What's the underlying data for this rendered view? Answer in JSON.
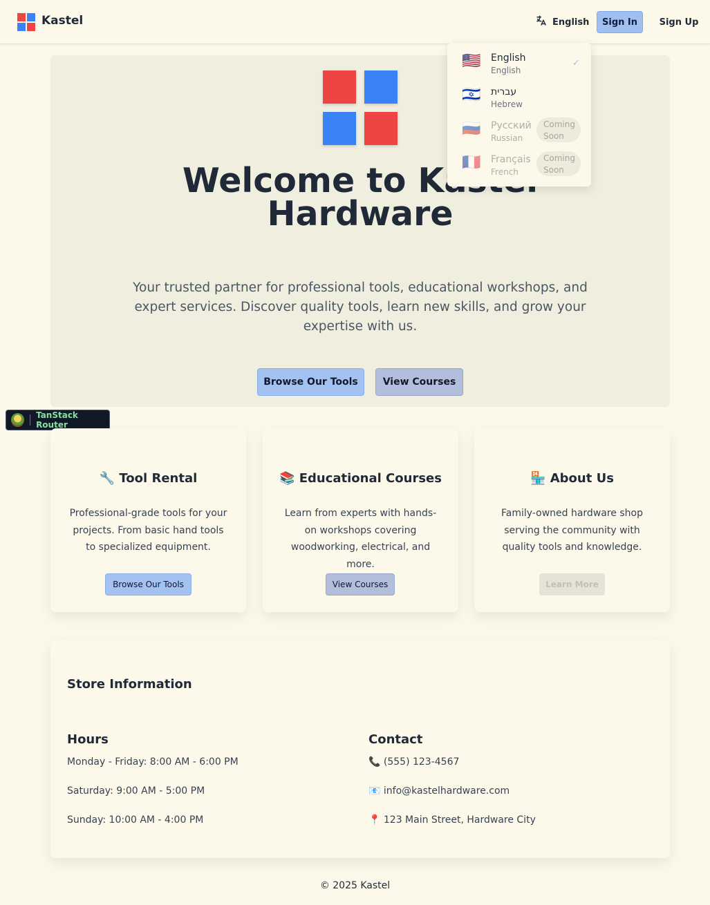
{
  "colors": {
    "brand_red": "#ef4444",
    "brand_blue": "#3b82f6",
    "primary_button": "#a3c2f2",
    "secondary_button": "#b2bedb"
  },
  "header": {
    "brand": "Kastel",
    "language_icon": "translate-icon",
    "language_label": "English",
    "sign_in": "Sign In",
    "sign_up": "Sign Up"
  },
  "language_menu": {
    "items": [
      {
        "flag": "🇺🇸",
        "name": "English",
        "sub": "English",
        "selected": true,
        "check": "✓"
      },
      {
        "flag": "🇮🇱",
        "name": "עברית",
        "sub": "Hebrew"
      },
      {
        "flag": "🇷🇺",
        "name": "Русский",
        "sub": "Russian",
        "badge": "Coming Soon"
      },
      {
        "flag": "🇫🇷",
        "name": "Français",
        "sub": "French",
        "badge": "Coming Soon"
      }
    ]
  },
  "hero": {
    "title": "Welcome to Kastel Hardware",
    "subtitle": "Your trusted partner for professional tools, educational workshops, and expert services. Discover quality tools, learn new skills, and grow your expertise with us.",
    "browse_button": "Browse Our Tools",
    "courses_button": "View Courses"
  },
  "devtools": {
    "label": "TanStack Router"
  },
  "features": [
    {
      "title": "🔧 Tool Rental",
      "description": "Professional-grade tools for your projects. From basic hand tools to specialized equipment.",
      "button": "Browse Our Tools"
    },
    {
      "title": "📚 Educational Courses",
      "description": "Learn from experts with hands-on workshops covering woodworking, electrical, and more.",
      "button": "View Courses"
    },
    {
      "title": "🏪 About Us",
      "description": "Family-owned hardware shop serving the community with quality tools and knowledge.",
      "button": "Learn More"
    }
  ],
  "store": {
    "title": "Store Information",
    "hours_title": "Hours",
    "hours": [
      "Monday - Friday: 8:00 AM - 6:00 PM",
      "Saturday: 9:00 AM - 5:00 PM",
      "Sunday: 10:00 AM - 4:00 PM"
    ],
    "contact_title": "Contact",
    "contact": [
      "📞 (555) 123-4567",
      "📧 info@kastelhardware.com",
      "📍 123 Main Street, Hardware City"
    ]
  },
  "footer": "© 2025 Kastel"
}
